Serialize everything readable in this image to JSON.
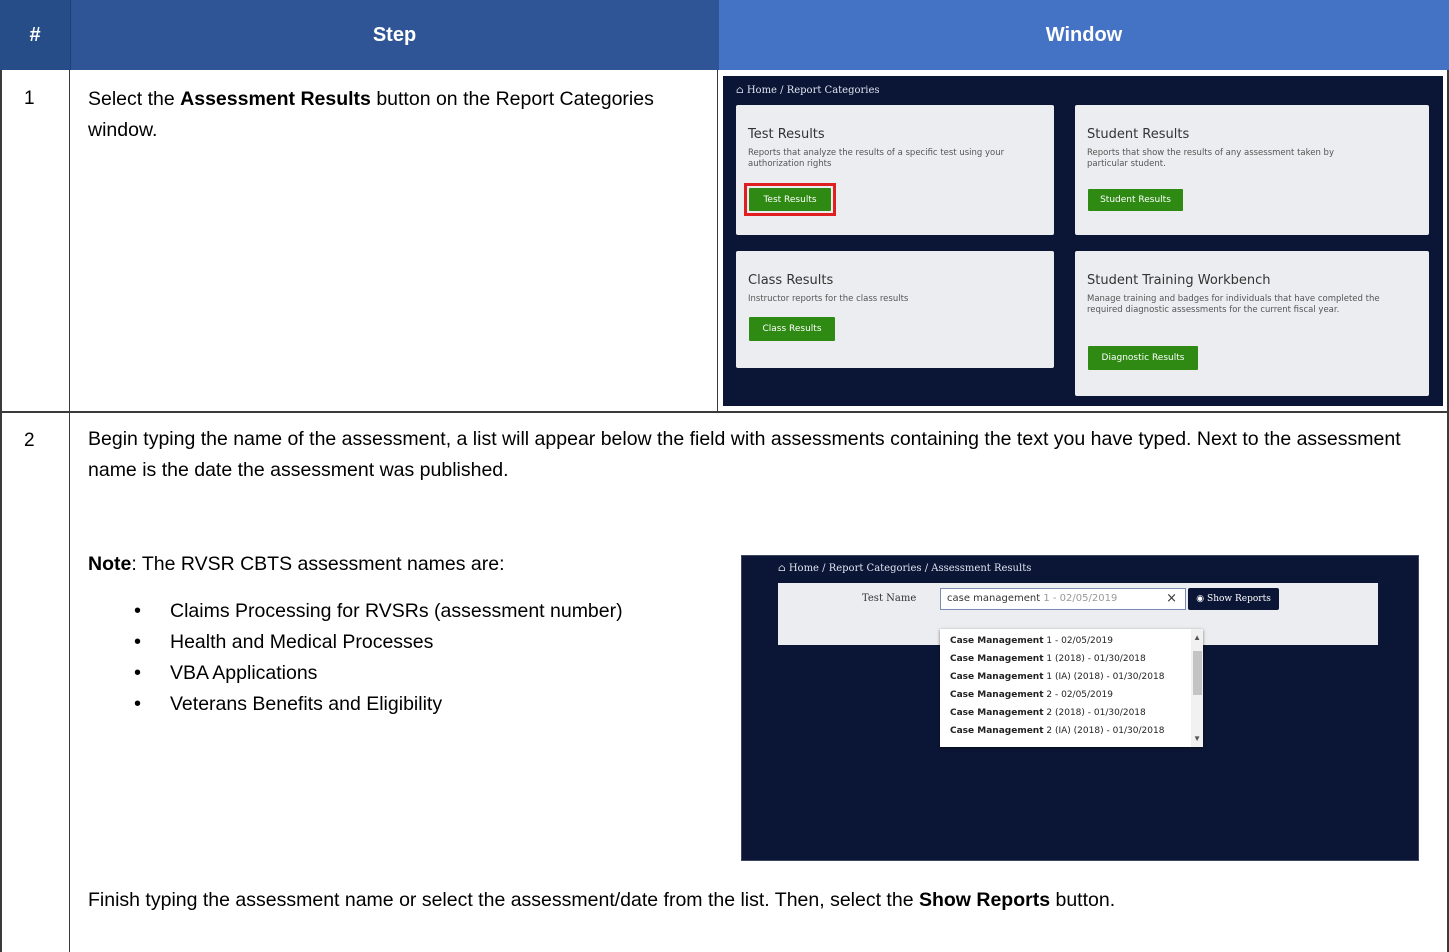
{
  "table": {
    "headers": {
      "num": "#",
      "step": "Step",
      "window": "Window"
    }
  },
  "step1": {
    "num": "1",
    "text_pre": "Select the ",
    "text_bold": "Assessment Results",
    "text_post": " button on the Report Categories window."
  },
  "screen1": {
    "home_icon": "home-icon",
    "breadcrumb": "Home  /  Report Categories",
    "cards": [
      {
        "title": "Test Results",
        "desc": "Reports that analyze the results of a specific test using your authorization rights",
        "button": "Test Results",
        "highlighted": true
      },
      {
        "title": "Student Results",
        "desc": "Reports that show the results of any assessment taken by particular student.",
        "button": "Student Results",
        "highlighted": false
      },
      {
        "title": "Class Results",
        "desc": "Instructor reports for the class results",
        "button": "Class Results",
        "highlighted": false
      },
      {
        "title": "Student Training Workbench",
        "desc": "Manage training and badges for individuals that have completed the required diagnostic assessments for the current fiscal year.",
        "button": "Diagnostic Results",
        "highlighted": false
      }
    ],
    "colors": {
      "background": "#0b1636",
      "card": "#ecedf0",
      "button": "#2e8a13",
      "highlight": "#e02020"
    }
  },
  "step2": {
    "num": "2",
    "intro": "Begin typing the name of the assessment, a list will appear below the field with assessments containing the text you have typed.  Next to the assessment name is the date the assessment was published.",
    "note_label": "Note",
    "note_text": ": The RVSR CBTS assessment names are:",
    "bullets": [
      "Claims Processing for RVSRs (assessment number)",
      "Health and Medical Processes",
      "VBA Applications",
      "Veterans Benefits and Eligibility"
    ],
    "finish_pre": "Finish typing the assessment name or select the assessment/date from the list.  Then, select the ",
    "finish_bold": "Show Reports",
    "finish_post": " button."
  },
  "screen2": {
    "breadcrumb": "Home  /  Report Categories  /  Assessment Results",
    "field_label": "Test Name",
    "input_value": "case management",
    "input_hint": " 1 - 02/05/2019",
    "clear_glyph": "×",
    "show_button": "Show Reports",
    "options": [
      {
        "name": "Case Management",
        "rest": " 1 - 02/05/2019"
      },
      {
        "name": "Case Management",
        "rest": " 1 (2018) - 01/30/2018"
      },
      {
        "name": "Case Management",
        "rest": " 1 (IA) (2018) - 01/30/2018"
      },
      {
        "name": "Case Management",
        "rest": " 2 - 02/05/2019"
      },
      {
        "name": "Case Management",
        "rest": " 2 (2018) - 01/30/2018"
      },
      {
        "name": "Case Management",
        "rest": " 2 (IA) (2018) - 01/30/2018"
      }
    ]
  }
}
